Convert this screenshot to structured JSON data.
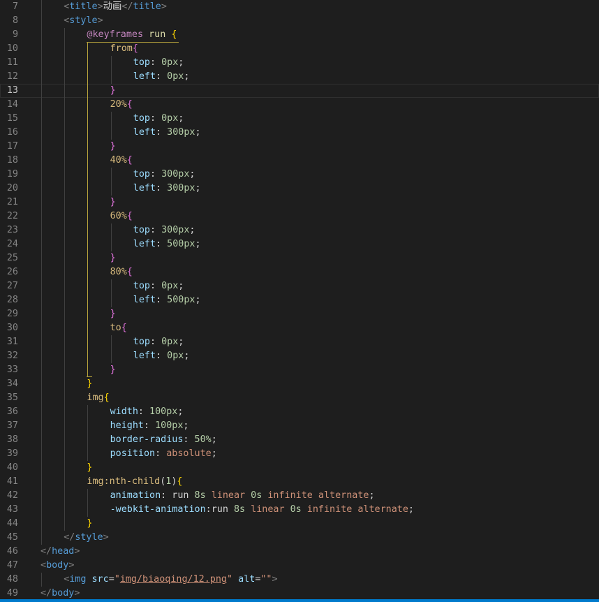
{
  "colors": {
    "background": "#1e1e1e",
    "status_bar": "#007acc",
    "active_indent_guide": "#b9a43c"
  },
  "editor": {
    "current_line": 13,
    "lines": [
      {
        "n": "7",
        "indent": 1,
        "tokens": [
          [
            "<",
            "t-punc"
          ],
          [
            "title",
            "t-tag"
          ],
          [
            ">",
            "t-punc"
          ],
          [
            "动画",
            "t-text"
          ],
          [
            "</",
            "t-punc"
          ],
          [
            "title",
            "t-tag"
          ],
          [
            ">",
            "t-punc"
          ]
        ]
      },
      {
        "n": "8",
        "indent": 1,
        "tokens": [
          [
            "<",
            "t-punc"
          ],
          [
            "style",
            "t-tag"
          ],
          [
            ">",
            "t-punc"
          ]
        ]
      },
      {
        "n": "9",
        "indent": 2,
        "tokens": [
          [
            "@keyframes",
            "t-at"
          ],
          [
            " ",
            "t-text"
          ],
          [
            "run",
            "t-name"
          ],
          [
            " ",
            "t-text"
          ],
          [
            "{",
            "b-gold"
          ]
        ]
      },
      {
        "n": "10",
        "indent": 3,
        "tokens": [
          [
            "from",
            "t-sel"
          ],
          [
            "{",
            "b-pink"
          ]
        ]
      },
      {
        "n": "11",
        "indent": 4,
        "tokens": [
          [
            "top",
            "t-prop"
          ],
          [
            ": ",
            "t-text"
          ],
          [
            "0px",
            "t-num"
          ],
          [
            ";",
            "t-text"
          ]
        ]
      },
      {
        "n": "12",
        "indent": 4,
        "tokens": [
          [
            "left",
            "t-prop"
          ],
          [
            ": ",
            "t-text"
          ],
          [
            "0px",
            "t-num"
          ],
          [
            ";",
            "t-text"
          ]
        ]
      },
      {
        "n": "13",
        "indent": 3,
        "tokens": [
          [
            "}",
            "b-pink"
          ]
        ]
      },
      {
        "n": "14",
        "indent": 3,
        "tokens": [
          [
            "20%",
            "t-sel"
          ],
          [
            "{",
            "b-pink"
          ]
        ]
      },
      {
        "n": "15",
        "indent": 4,
        "tokens": [
          [
            "top",
            "t-prop"
          ],
          [
            ": ",
            "t-text"
          ],
          [
            "0px",
            "t-num"
          ],
          [
            ";",
            "t-text"
          ]
        ]
      },
      {
        "n": "16",
        "indent": 4,
        "tokens": [
          [
            "left",
            "t-prop"
          ],
          [
            ": ",
            "t-text"
          ],
          [
            "300px",
            "t-num"
          ],
          [
            ";",
            "t-text"
          ]
        ]
      },
      {
        "n": "17",
        "indent": 3,
        "tokens": [
          [
            "}",
            "b-pink"
          ]
        ]
      },
      {
        "n": "18",
        "indent": 3,
        "tokens": [
          [
            "40%",
            "t-sel"
          ],
          [
            "{",
            "b-pink"
          ]
        ]
      },
      {
        "n": "19",
        "indent": 4,
        "tokens": [
          [
            "top",
            "t-prop"
          ],
          [
            ": ",
            "t-text"
          ],
          [
            "300px",
            "t-num"
          ],
          [
            ";",
            "t-text"
          ]
        ]
      },
      {
        "n": "20",
        "indent": 4,
        "tokens": [
          [
            "left",
            "t-prop"
          ],
          [
            ": ",
            "t-text"
          ],
          [
            "300px",
            "t-num"
          ],
          [
            ";",
            "t-text"
          ]
        ]
      },
      {
        "n": "21",
        "indent": 3,
        "tokens": [
          [
            "}",
            "b-pink"
          ]
        ]
      },
      {
        "n": "22",
        "indent": 3,
        "tokens": [
          [
            "60%",
            "t-sel"
          ],
          [
            "{",
            "b-pink"
          ]
        ]
      },
      {
        "n": "23",
        "indent": 4,
        "tokens": [
          [
            "top",
            "t-prop"
          ],
          [
            ": ",
            "t-text"
          ],
          [
            "300px",
            "t-num"
          ],
          [
            ";",
            "t-text"
          ]
        ]
      },
      {
        "n": "24",
        "indent": 4,
        "tokens": [
          [
            "left",
            "t-prop"
          ],
          [
            ": ",
            "t-text"
          ],
          [
            "500px",
            "t-num"
          ],
          [
            ";",
            "t-text"
          ]
        ]
      },
      {
        "n": "25",
        "indent": 3,
        "tokens": [
          [
            "}",
            "b-pink"
          ]
        ]
      },
      {
        "n": "26",
        "indent": 3,
        "tokens": [
          [
            "80%",
            "t-sel"
          ],
          [
            "{",
            "b-pink"
          ]
        ]
      },
      {
        "n": "27",
        "indent": 4,
        "tokens": [
          [
            "top",
            "t-prop"
          ],
          [
            ": ",
            "t-text"
          ],
          [
            "0px",
            "t-num"
          ],
          [
            ";",
            "t-text"
          ]
        ]
      },
      {
        "n": "28",
        "indent": 4,
        "tokens": [
          [
            "left",
            "t-prop"
          ],
          [
            ": ",
            "t-text"
          ],
          [
            "500px",
            "t-num"
          ],
          [
            ";",
            "t-text"
          ]
        ]
      },
      {
        "n": "29",
        "indent": 3,
        "tokens": [
          [
            "}",
            "b-pink"
          ]
        ]
      },
      {
        "n": "30",
        "indent": 3,
        "tokens": [
          [
            "to",
            "t-sel"
          ],
          [
            "{",
            "b-pink"
          ]
        ]
      },
      {
        "n": "31",
        "indent": 4,
        "tokens": [
          [
            "top",
            "t-prop"
          ],
          [
            ": ",
            "t-text"
          ],
          [
            "0px",
            "t-num"
          ],
          [
            ";",
            "t-text"
          ]
        ]
      },
      {
        "n": "32",
        "indent": 4,
        "tokens": [
          [
            "left",
            "t-prop"
          ],
          [
            ": ",
            "t-text"
          ],
          [
            "0px",
            "t-num"
          ],
          [
            ";",
            "t-text"
          ]
        ]
      },
      {
        "n": "33",
        "indent": 3,
        "tokens": [
          [
            "}",
            "b-pink"
          ]
        ]
      },
      {
        "n": "34",
        "indent": 2,
        "tokens": [
          [
            "}",
            "b-gold"
          ]
        ]
      },
      {
        "n": "35",
        "indent": 2,
        "tokens": [
          [
            "img",
            "t-sel"
          ],
          [
            "{",
            "b-gold"
          ]
        ]
      },
      {
        "n": "36",
        "indent": 3,
        "tokens": [
          [
            "width",
            "t-prop"
          ],
          [
            ": ",
            "t-text"
          ],
          [
            "100px",
            "t-num"
          ],
          [
            ";",
            "t-text"
          ]
        ]
      },
      {
        "n": "37",
        "indent": 3,
        "tokens": [
          [
            "height",
            "t-prop"
          ],
          [
            ": ",
            "t-text"
          ],
          [
            "100px",
            "t-num"
          ],
          [
            ";",
            "t-text"
          ]
        ]
      },
      {
        "n": "38",
        "indent": 3,
        "tokens": [
          [
            "border-radius",
            "t-prop"
          ],
          [
            ": ",
            "t-text"
          ],
          [
            "50%",
            "t-num"
          ],
          [
            ";",
            "t-text"
          ]
        ]
      },
      {
        "n": "39",
        "indent": 3,
        "tokens": [
          [
            "position",
            "t-prop"
          ],
          [
            ": ",
            "t-text"
          ],
          [
            "absolute",
            "t-val"
          ],
          [
            ";",
            "t-text"
          ]
        ]
      },
      {
        "n": "40",
        "indent": 2,
        "tokens": [
          [
            "}",
            "b-gold"
          ]
        ]
      },
      {
        "n": "41",
        "indent": 2,
        "tokens": [
          [
            "img:nth-child",
            "t-sel"
          ],
          [
            "(",
            "b-plain"
          ],
          [
            "1",
            "t-num"
          ],
          [
            ")",
            "b-plain"
          ],
          [
            "{",
            "b-gold"
          ]
        ]
      },
      {
        "n": "42",
        "indent": 3,
        "tokens": [
          [
            "animation",
            "t-prop"
          ],
          [
            ": ",
            "t-text"
          ],
          [
            "run",
            "t-text"
          ],
          [
            " ",
            "t-text"
          ],
          [
            "8s",
            "t-num"
          ],
          [
            " ",
            "t-text"
          ],
          [
            "linear",
            "t-val"
          ],
          [
            " ",
            "t-text"
          ],
          [
            "0s",
            "t-num"
          ],
          [
            " ",
            "t-text"
          ],
          [
            "infinite",
            "t-val"
          ],
          [
            " ",
            "t-text"
          ],
          [
            "alternate",
            "t-val"
          ],
          [
            ";",
            "t-text"
          ]
        ]
      },
      {
        "n": "43",
        "indent": 3,
        "tokens": [
          [
            "-webkit-animation",
            "t-prop"
          ],
          [
            ":",
            "t-text"
          ],
          [
            "run",
            "t-text"
          ],
          [
            " ",
            "t-text"
          ],
          [
            "8s",
            "t-num"
          ],
          [
            " ",
            "t-text"
          ],
          [
            "linear",
            "t-val"
          ],
          [
            " ",
            "t-text"
          ],
          [
            "0s",
            "t-num"
          ],
          [
            " ",
            "t-text"
          ],
          [
            "infinite",
            "t-val"
          ],
          [
            " ",
            "t-text"
          ],
          [
            "alternate",
            "t-val"
          ],
          [
            ";",
            "t-text"
          ]
        ]
      },
      {
        "n": "44",
        "indent": 2,
        "tokens": [
          [
            "}",
            "b-gold"
          ]
        ]
      },
      {
        "n": "45",
        "indent": 1,
        "tokens": [
          [
            "</",
            "t-punc"
          ],
          [
            "style",
            "t-tag"
          ],
          [
            ">",
            "t-punc"
          ]
        ]
      },
      {
        "n": "46",
        "indent": 0,
        "tokens": [
          [
            "</",
            "t-punc"
          ],
          [
            "head",
            "t-tag"
          ],
          [
            ">",
            "t-punc"
          ]
        ]
      },
      {
        "n": "47",
        "indent": 0,
        "tokens": [
          [
            "<",
            "t-punc"
          ],
          [
            "body",
            "t-tag"
          ],
          [
            ">",
            "t-punc"
          ]
        ]
      },
      {
        "n": "48",
        "indent": 1,
        "tokens": [
          [
            "<",
            "t-punc"
          ],
          [
            "img",
            "t-tag"
          ],
          [
            " ",
            "t-text"
          ],
          [
            "src",
            "t-attr"
          ],
          [
            "=",
            "t-text"
          ],
          [
            "\"",
            "t-str"
          ],
          [
            "img/biaoqing/12.png",
            "t-str-u"
          ],
          [
            "\"",
            "t-str"
          ],
          [
            " ",
            "t-text"
          ],
          [
            "alt",
            "t-attr"
          ],
          [
            "=",
            "t-text"
          ],
          [
            "\"\"",
            "t-str"
          ],
          [
            ">",
            "t-punc"
          ]
        ]
      },
      {
        "n": "49",
        "indent": 0,
        "tokens": [
          [
            "</",
            "t-punc"
          ],
          [
            "body",
            "t-tag"
          ],
          [
            ">",
            "t-punc"
          ]
        ]
      }
    ]
  }
}
